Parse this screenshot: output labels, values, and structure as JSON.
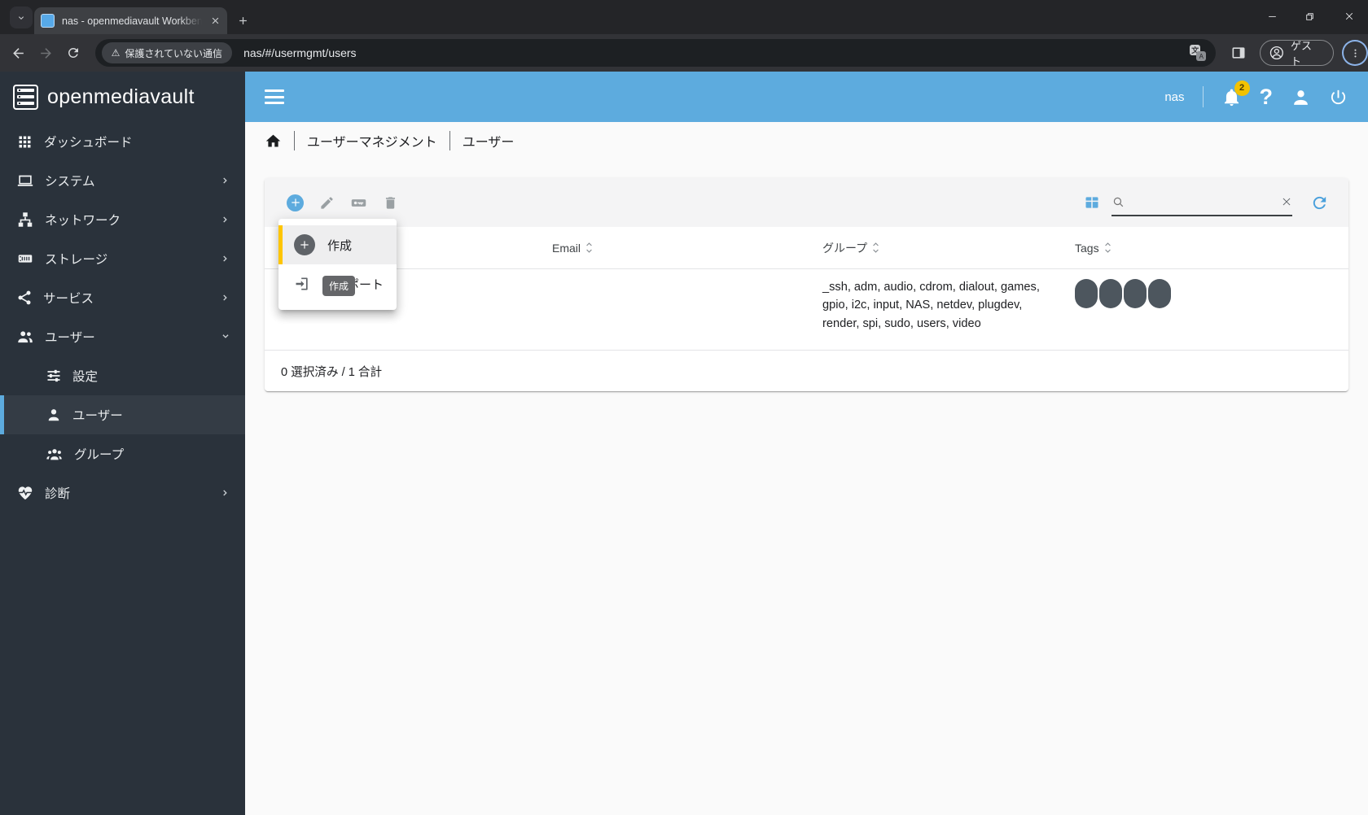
{
  "browser": {
    "tab_title": "nas - openmediavault Workbench",
    "security_chip": "保護されていない通信",
    "url": "nas/#/usermgmt/users",
    "profile_label": "ゲスト"
  },
  "sidebar": {
    "logo_text": "openmediavault",
    "items": [
      {
        "label": "ダッシュボード"
      },
      {
        "label": "システム"
      },
      {
        "label": "ネットワーク"
      },
      {
        "label": "ストレージ"
      },
      {
        "label": "サービス"
      },
      {
        "label": "ユーザー"
      },
      {
        "label": "設定"
      },
      {
        "label": "ユーザー"
      },
      {
        "label": "グループ"
      },
      {
        "label": "診断"
      }
    ]
  },
  "appbar": {
    "hostname": "nas",
    "notification_count": "2"
  },
  "breadcrumb": {
    "level1": "ユーザーマネジメント",
    "level2": "ユーザー"
  },
  "table": {
    "headers": {
      "email": "Email",
      "groups": "グループ",
      "tags": "Tags"
    },
    "row": {
      "groups": "_ssh, adm, audio, cdrom, dialout, games, gpio, i2c, input, NAS, netdev, plugdev, render, spi, sudo, users, video",
      "tag_pill_count": 4
    },
    "footer": "0 選択済み / 1 合計"
  },
  "menu": {
    "create_label": "作成",
    "import_label": "インポート",
    "tooltip": "作成"
  },
  "colors": {
    "accent": "#5dabde",
    "warning_yellow": "#fec500",
    "badge_yellow": "#f3c200",
    "tag_pill": "#4d565e",
    "tooltip_bg": "#656669"
  }
}
